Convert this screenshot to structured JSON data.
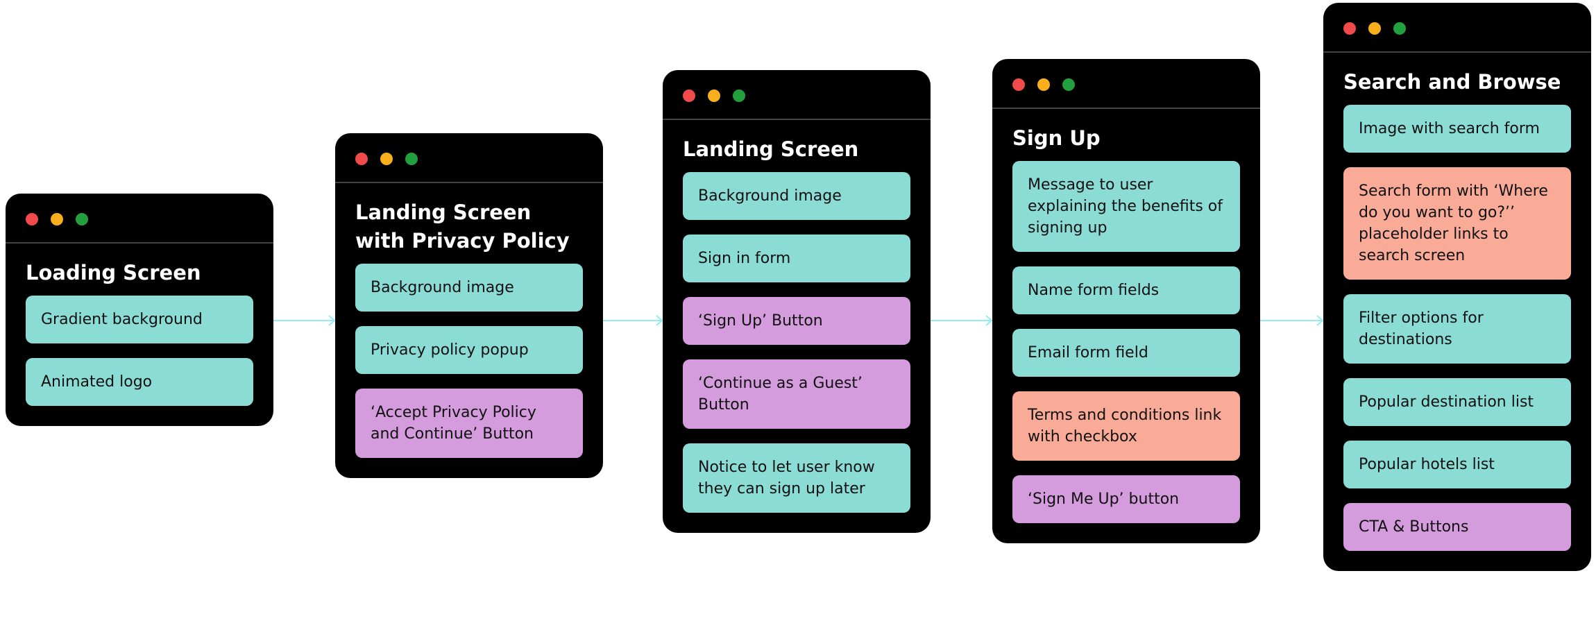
{
  "colors": {
    "teal": "#8cdcd6",
    "purple": "#d49cdc",
    "salmon": "#f9ab98",
    "window": "#000000",
    "arrow": "#8ff0ec"
  },
  "screens": [
    {
      "title": "Loading Screen",
      "items": [
        {
          "label": "Gradient background",
          "color": "teal"
        },
        {
          "label": "Animated logo",
          "color": "teal"
        }
      ]
    },
    {
      "title": "Landing Screen with Privacy Policy",
      "items": [
        {
          "label": "Background image",
          "color": "teal"
        },
        {
          "label": "Privacy policy popup",
          "color": "teal"
        },
        {
          "label": "‘Accept Privacy Policy and Continue’ Button",
          "color": "purple"
        }
      ]
    },
    {
      "title": "Landing Screen",
      "items": [
        {
          "label": "Background image",
          "color": "teal"
        },
        {
          "label": "Sign in form",
          "color": "teal"
        },
        {
          "label": "‘Sign Up’ Button",
          "color": "purple"
        },
        {
          "label": "‘Continue as a Guest’ Button",
          "color": "purple"
        },
        {
          "label": "Notice to let user know they can sign up later",
          "color": "teal"
        }
      ]
    },
    {
      "title": "Sign Up",
      "items": [
        {
          "label": "Message to user explaining the benefits of signing up",
          "color": "teal"
        },
        {
          "label": "Name form fields",
          "color": "teal"
        },
        {
          "label": "Email form field",
          "color": "teal"
        },
        {
          "label": "Terms and conditions link with checkbox",
          "color": "salmon"
        },
        {
          "label": "‘Sign Me Up’ button",
          "color": "purple"
        }
      ]
    },
    {
      "title": "Search and Browse",
      "items": [
        {
          "label": "Image with search form",
          "color": "teal"
        },
        {
          "label": "Search form with ‘Where do you want to go?’’ placeholder links to search screen",
          "color": "salmon"
        },
        {
          "label": "Filter options for destinations",
          "color": "teal"
        },
        {
          "label": "Popular destination list",
          "color": "teal"
        },
        {
          "label": "Popular hotels list",
          "color": "teal"
        },
        {
          "label": "CTA & Buttons",
          "color": "purple"
        }
      ]
    }
  ]
}
